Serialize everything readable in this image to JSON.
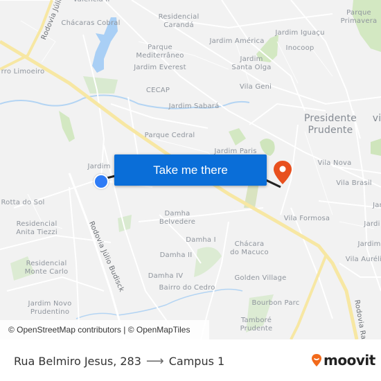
{
  "map": {
    "labels": {
      "valencia": "Valência II",
      "chacaras_cobral": "Chácaras Cobral",
      "residencial_caranda": "Residencial\nCarandá",
      "parque_primavera": "Parque\nPrimavera",
      "jardim_iguacu": "Jardim Iguaçu",
      "jardim_america": "Jardim América",
      "inocoop": "Inocoop",
      "parque_mediterraneo": "Parque\nMediterrâneo",
      "jardim_everest": "Jardim Everest",
      "jardim_santa_olga": "Jardim\nSanta Olga",
      "bairro_limoeiro": "rro Limoeiro",
      "cecap": "CECAP",
      "vila_geni": "Vila Geni",
      "jardim_sabara": "Jardim Sabará",
      "presidente_prudente": "Presidente\nPrudente",
      "vi_partial": "vi",
      "parque_cedral": "Parque Cedral",
      "jardim_paris": "Jardim Paris",
      "jardim_partial": "Jardim",
      "vila_nova": "Vila Nova",
      "vila_brasil": "Vila Brasil",
      "rotta_do_sol": "Rotta do Sol",
      "jar_partial": "Jar",
      "residencial_anita_tiezzi": "Residencial\nAnita Tiezzi",
      "damha_belvedere": "Damha\nBelvedere",
      "vila_formosa": "Vila Formosa",
      "jardim_partial_2": "Jardi",
      "damha_i": "Damha I",
      "chacara_do_macuco": "Chácara\ndo Macuco",
      "jardim_partial_3": "Jardim",
      "residencial_monte_carlo": "Residencial\nMonte Carlo",
      "damha_ii": "Damha II",
      "vila_aurelia": "Vila Auréli",
      "damha_iv": "Damha IV",
      "bairro_do_cedro": "Bairro do Cedro",
      "golden_village": "Golden Village",
      "jardim_novo_prudentino": "Jardim Novo\nPrudentino",
      "bourbon_parc": "Bourbon Parc",
      "tambore_prudente": "Tamboré\nPrudente"
    },
    "roads": {
      "rodovia_julio_top": "Rodovia Júlio",
      "rodovia_julio_budisck": "Rodovia Júlio Budisck",
      "rodovia_ra": "Rodovia Ra"
    },
    "cta_label": "Take me there",
    "attribution": "© OpenStreetMap contributors | © OpenMapTiles",
    "colors": {
      "cta": "#0a6ed8",
      "origin": "#2f7cf6",
      "destination": "#e8501e",
      "highway": "#f7e7a3",
      "water": "#a9cff5",
      "park": "#cfe5bc"
    }
  },
  "footer": {
    "origin": "Rua Belmiro Jesus, 283",
    "arrow": "⟶",
    "destination": "Campus 1",
    "brand": "moovit",
    "brand_color": "#f26a1b"
  }
}
